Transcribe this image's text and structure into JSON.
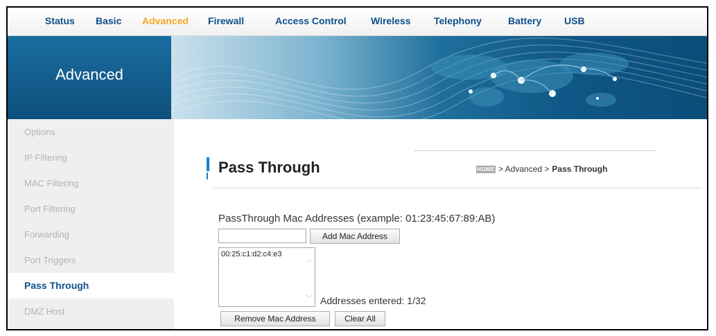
{
  "topnav": {
    "items": [
      {
        "label": "Status"
      },
      {
        "label": "Basic"
      },
      {
        "label": "Advanced",
        "active": true
      },
      {
        "label": "Firewall"
      },
      {
        "label": "Access Control"
      },
      {
        "label": "Wireless"
      },
      {
        "label": "Telephony"
      },
      {
        "label": "Battery"
      },
      {
        "label": "USB"
      }
    ]
  },
  "banner": {
    "title": "Advanced"
  },
  "sidebar": {
    "items": [
      {
        "label": "Options"
      },
      {
        "label": "IP Filtering"
      },
      {
        "label": "MAC Filtering"
      },
      {
        "label": "Port Filtering"
      },
      {
        "label": "Forwarding"
      },
      {
        "label": "Port Triggers"
      },
      {
        "label": "Pass Through",
        "active": true
      },
      {
        "label": "DMZ Host"
      }
    ]
  },
  "main": {
    "title": "Pass Through",
    "breadcrumb": {
      "home_icon_text": "HOME",
      "path": "> Advanced >",
      "current": "Pass Through"
    },
    "section_label": "PassThrough Mac Addresses (example: 01:23:45:67:89:AB)",
    "mac_input": {
      "value": "",
      "placeholder": ""
    },
    "add_button": "Add Mac Address",
    "entries": [
      "00:25:c1:d2:c4:e3"
    ],
    "count_label": "Addresses entered: 1/32",
    "remove_button": "Remove Mac Address",
    "clear_button": "Clear All"
  },
  "colors": {
    "nav_text": "#0f4f8a",
    "nav_active": "#f5a623",
    "accent_blue": "#1a80c4",
    "sidebar_bg": "#efefef"
  }
}
